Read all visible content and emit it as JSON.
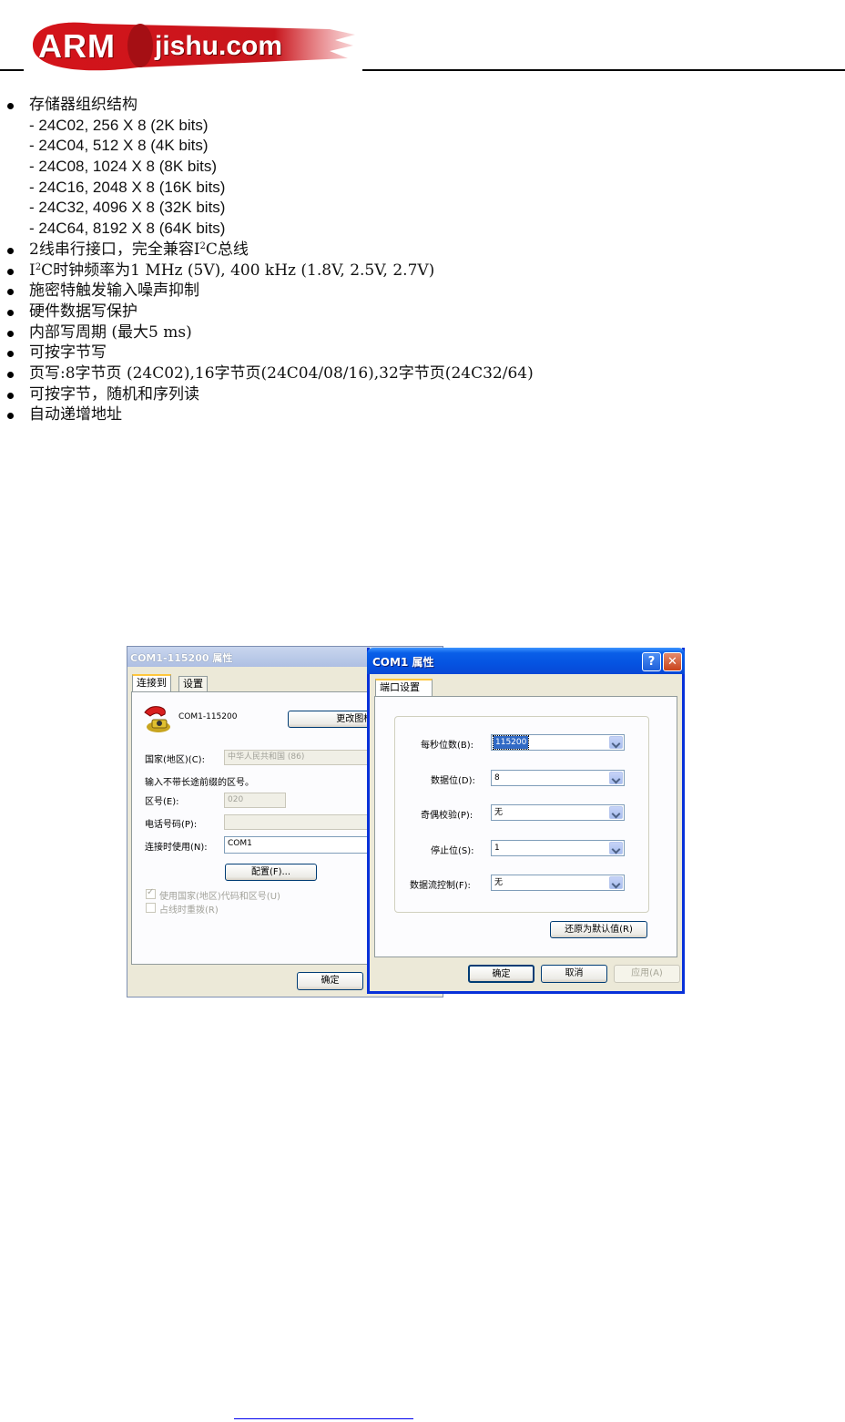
{
  "header": {
    "logo_arm": "ARM",
    "logo_domain": "jishu.com"
  },
  "features": [
    {
      "bullet": true,
      "text": "存储器组织结构"
    },
    {
      "bullet": false,
      "text": "- 24C02, 256 X 8 (2K bits)"
    },
    {
      "bullet": false,
      "text": "- 24C04, 512 X 8 (4K bits)"
    },
    {
      "bullet": false,
      "text": "- 24C08, 1024 X 8 (8K bits)"
    },
    {
      "bullet": false,
      "text": "- 24C16, 2048 X 8 (16K bits)"
    },
    {
      "bullet": false,
      "text": "- 24C32, 4096 X 8 (32K bits)"
    },
    {
      "bullet": false,
      "text": "- 24C64, 8192 X 8 (64K bits)"
    },
    {
      "bullet": true,
      "text_pre": "2线串行接口，完全兼容I",
      "sup": "2",
      "text_post": "C总线"
    },
    {
      "bullet": true,
      "text_pre": "I",
      "sup": "2",
      "text_post": "C时钟频率为1 MHz (5V), 400 kHz (1.8V, 2.5V, 2.7V)"
    },
    {
      "bullet": true,
      "text": "施密特触发输入噪声抑制"
    },
    {
      "bullet": true,
      "text": "硬件数据写保护"
    },
    {
      "bullet": true,
      "text": "内部写周期 (最大5 ms)"
    },
    {
      "bullet": true,
      "text": "可按字节写"
    },
    {
      "bullet": true,
      "text": "页写:8字节页 (24C02),16字节页(24C04/08/16),32字节页(24C32/64)"
    },
    {
      "bullet": true,
      "text": "可按字节，随机和序列读"
    },
    {
      "bullet": true,
      "text": "自动递增地址"
    }
  ],
  "back_window": {
    "title": "COM1-115200 属性",
    "tabs": [
      "连接到",
      "设置"
    ],
    "connection_name": "COM1-115200",
    "change_icon_button": "更改图标 (I)...",
    "country_label": "国家(地区)(C):",
    "country_value": "中华人民共和国 (86)",
    "hint": "输入不带长途前缀的区号。",
    "area_code_label": "区号(E):",
    "area_code_value": "020",
    "phone_label": "电话号码(P):",
    "phone_value": "",
    "connect_using_label": "连接时使用(N):",
    "connect_using_value": "COM1",
    "configure_button": "配置(F)...",
    "use_country_code": "使用国家(地区)代码和区号(U)",
    "redial_on_busy": "占线时重拨(R)",
    "ok_button": "确定"
  },
  "front_window": {
    "title": "COM1 属性",
    "help_glyph": "?",
    "close_glyph": "✕",
    "tab": "端口设置",
    "fields": [
      {
        "label": "每秒位数(B):",
        "value": "115200",
        "selected": true
      },
      {
        "label": "数据位(D):",
        "value": "8",
        "selected": false
      },
      {
        "label": "奇偶校验(P):",
        "value": "无",
        "selected": false
      },
      {
        "label": "停止位(S):",
        "value": "1",
        "selected": false
      },
      {
        "label": "数据流控制(F):",
        "value": "无",
        "selected": false
      }
    ],
    "restore_defaults_button": "还原为默认值(R)",
    "ok_button": "确定",
    "cancel_button": "取消",
    "apply_button": "应用(A)"
  },
  "colors": {
    "xp_title_blue": "#0553e1",
    "xp_face": "#ece9d8",
    "selection": "#316ac5",
    "logo_red": "#c8161d"
  }
}
